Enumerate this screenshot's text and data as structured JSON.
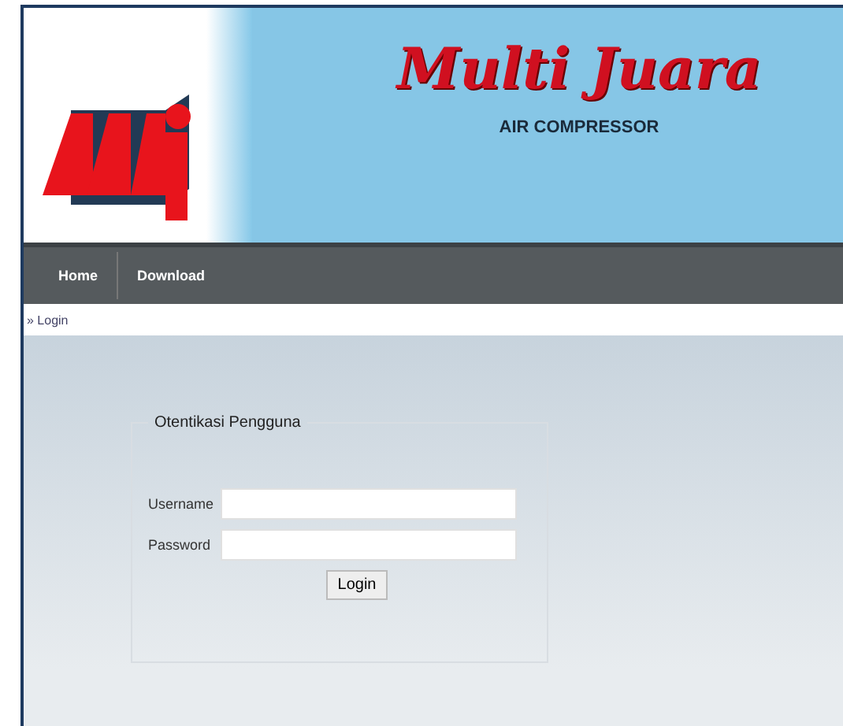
{
  "header": {
    "title": "Multi Juara",
    "subtitle": "AIR COMPRESSOR"
  },
  "nav": [
    {
      "label": "Home"
    },
    {
      "label": "Download"
    }
  ],
  "breadcrumb": "» Login",
  "login": {
    "legend": "Otentikasi Pengguna",
    "fields": [
      {
        "label": "Username"
      },
      {
        "label": "Password"
      }
    ],
    "button": "Login"
  }
}
